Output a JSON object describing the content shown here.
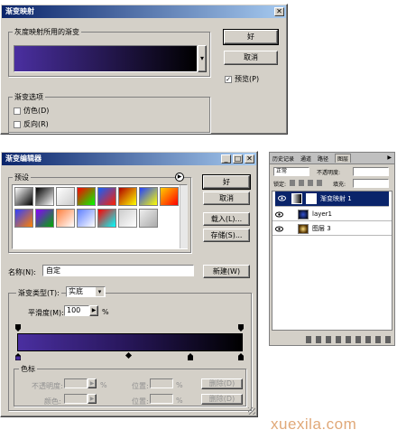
{
  "gradient_map": {
    "title": "渐变映射",
    "close_icon": "close-icon",
    "group_label": "灰度映射所用的渐变",
    "ok_label": "好",
    "cancel_label": "取消",
    "preview_label": "预览(P)",
    "preview_checked": true,
    "options_label": "渐变选项",
    "dither_label": "仿色(D)",
    "reverse_label": "反向(R)",
    "gradient_colors": [
      "#4a2fa0",
      "#000000"
    ]
  },
  "gradient_editor": {
    "title": "渐变编辑器",
    "presets_label": "预设",
    "ok_label": "好",
    "cancel_label": "取消",
    "load_label": "载入(L)...",
    "save_label": "存储(S)...",
    "name_label": "名称(N):",
    "name_value": "自定",
    "new_label": "新建(W)",
    "type_label": "渐变类型(T):",
    "type_value": "实底",
    "smooth_label": "平滑度(M):",
    "smooth_value": "100",
    "smooth_unit": "%",
    "stops_label": "色标",
    "opacity_label": "不透明度:",
    "location_label": "位置:",
    "delete_label": "删除(D)",
    "color_label": "颜色:",
    "pct": "%",
    "gradient_colors": [
      "#4a2fa0",
      "#000000"
    ],
    "presets": [
      [
        "#ffffff",
        "#000000"
      ],
      [
        "#000000",
        "#ffffff"
      ],
      [
        "#ffffff",
        "#cccccc"
      ],
      [
        "#ff0000",
        "#00ff00"
      ],
      [
        "#1060ff",
        "#ff2000"
      ],
      [
        "#b00000",
        "#ffff00"
      ],
      [
        "#2040ff",
        "#ffff00"
      ],
      [
        "#ffcc00",
        "#ff0000"
      ],
      [
        "#3040ff",
        "#ff8000"
      ],
      [
        "#8800ff",
        "#00aa00"
      ],
      [
        "#ff8040",
        "#ffffff"
      ],
      [
        "#6080ff",
        "#ffffff"
      ],
      [
        "#ff0000",
        "#00ffff"
      ],
      [
        "#cccccc",
        "#ffffff"
      ],
      [
        "#eeeeee",
        "#aaaaaa"
      ]
    ]
  },
  "layers_panel": {
    "tabs": [
      "历史记录",
      "通道",
      "路径",
      "图层"
    ],
    "blend_mode": "正常",
    "opacity_label": "不透明度:",
    "lock_label": "锁定:",
    "fill_label": "填充:",
    "layers": [
      {
        "name": "渐变映射 1",
        "selected": true
      },
      {
        "name": "layer1",
        "selected": false
      },
      {
        "name": "图层 3",
        "selected": false
      }
    ]
  },
  "watermark": "xuexila.com"
}
